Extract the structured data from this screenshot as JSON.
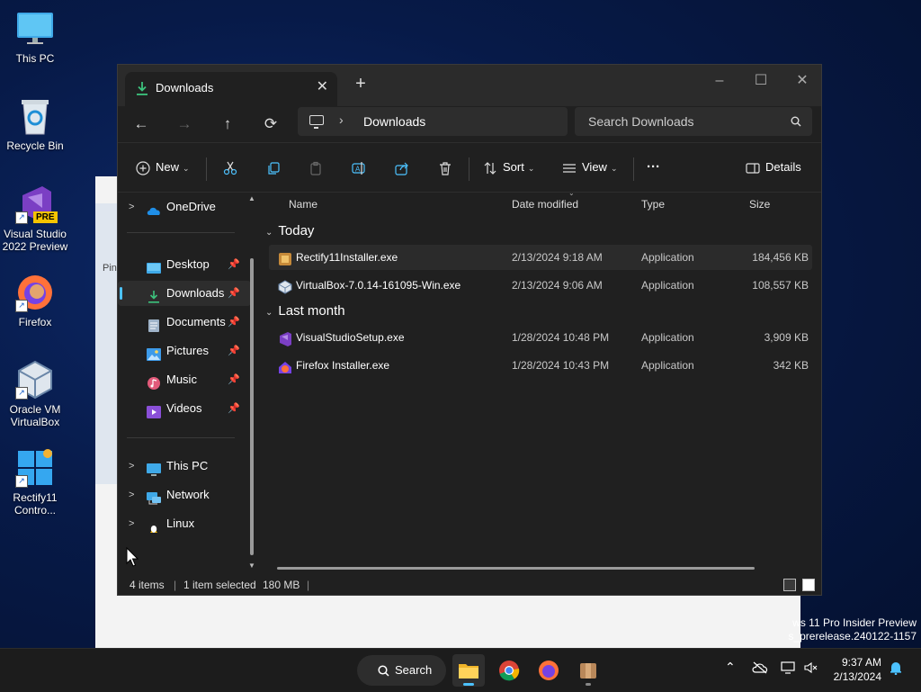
{
  "desktop": {
    "icons": [
      {
        "label_line1": "This PC",
        "label_line2": ""
      },
      {
        "label_line1": "Recycle Bin",
        "label_line2": ""
      },
      {
        "label_line1": "Visual Studio",
        "label_line2": "2022 Preview",
        "badge": "PRE"
      },
      {
        "label_line1": "Firefox",
        "label_line2": ""
      },
      {
        "label_line1": "Oracle VM",
        "label_line2": "VirtualBox"
      },
      {
        "label_line1": "Rectify11",
        "label_line2": "Contro..."
      }
    ],
    "bg_window_text": "Pin",
    "watermark_line1": "ws 11 Pro Insider Preview",
    "watermark_line2": "s_prerelease.240122-1157"
  },
  "explorer": {
    "tab_title": "Downloads",
    "address": {
      "crumb": "Downloads"
    },
    "search_placeholder": "Search Downloads",
    "toolbar": {
      "new_label": "New",
      "sort_label": "Sort",
      "view_label": "View",
      "more_label": "···",
      "details_label": "Details"
    },
    "nav": {
      "onedrive": "OneDrive",
      "quick": [
        {
          "label": "Desktop"
        },
        {
          "label": "Downloads"
        },
        {
          "label": "Documents"
        },
        {
          "label": "Pictures"
        },
        {
          "label": "Music"
        },
        {
          "label": "Videos"
        }
      ],
      "this_pc": "This PC",
      "network": "Network",
      "linux": "Linux"
    },
    "columns": {
      "name": "Name",
      "date": "Date modified",
      "type": "Type",
      "size": "Size"
    },
    "groups": [
      {
        "label": "Today",
        "files": [
          {
            "name": "Rectify11Installer.exe",
            "date": "2/13/2024 9:18 AM",
            "type": "Application",
            "size": "184,456 KB"
          },
          {
            "name": "VirtualBox-7.0.14-161095-Win.exe",
            "date": "2/13/2024 9:06 AM",
            "type": "Application",
            "size": "108,557 KB"
          }
        ]
      },
      {
        "label": "Last month",
        "files": [
          {
            "name": "VisualStudioSetup.exe",
            "date": "1/28/2024 10:48 PM",
            "type": "Application",
            "size": "3,909 KB"
          },
          {
            "name": "Firefox Installer.exe",
            "date": "1/28/2024 10:43 PM",
            "type": "Application",
            "size": "342 KB"
          }
        ]
      }
    ],
    "status": {
      "count": "4 items",
      "selected": "1 item selected",
      "size": "180 MB"
    }
  },
  "taskbar": {
    "search_label": "Search",
    "time": "9:37 AM",
    "date": "2/13/2024"
  },
  "colors": {
    "accent": "#4cc2ff",
    "window_bg": "#202020",
    "taskbar_bg": "#1c1c1c"
  }
}
